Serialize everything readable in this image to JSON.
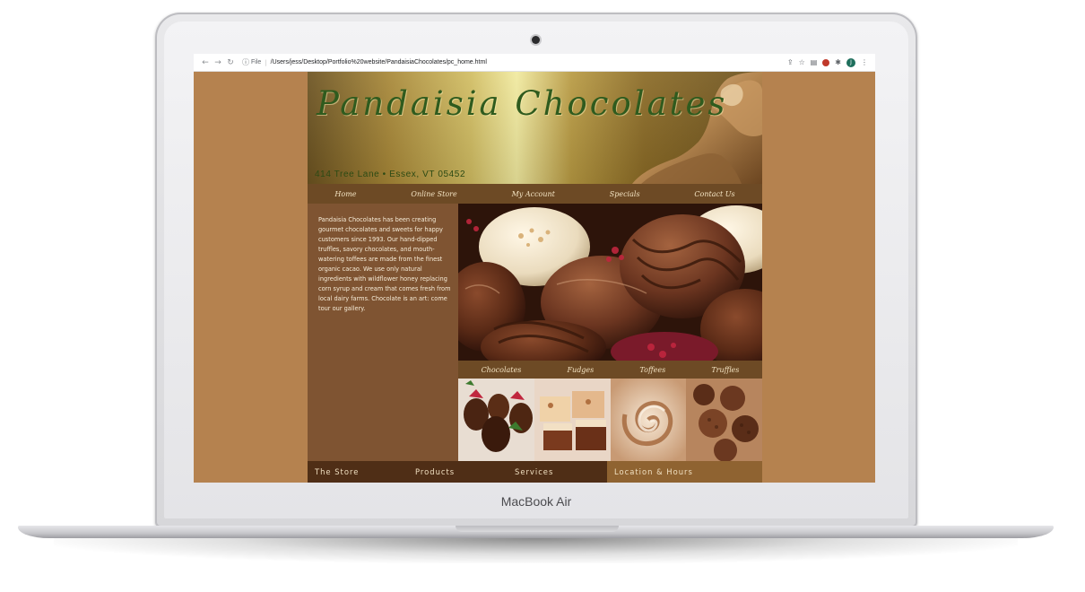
{
  "device": {
    "brand_label": "MacBook Air"
  },
  "browser": {
    "back_icon": "arrow-left-icon",
    "forward_icon": "arrow-right-icon",
    "reload_icon": "reload-icon",
    "protocol_label": "File",
    "url": "/Users/jess/Desktop/Portfolio%20website/PandaisiaChocolates/pc_home.html",
    "profile_initial": "J"
  },
  "site": {
    "title": "Pandaisia Chocolates",
    "address": "414 Tree Lane • Essex, VT 05452",
    "nav": [
      "Home",
      "Online Store",
      "My Account",
      "Specials",
      "Contact Us"
    ],
    "intro": "Pandaisia Chocolates has been creating gourmet chocolates and sweets for happy customers since 1993. Our hand-dipped truffles, savory chocolates, and mouth-watering toffees are made from the finest organic cacao. We use only natural ingredients with wildflower honey replacing corn syrup and cream that comes fresh from local dairy farms. Chocolate is an art: come tour our gallery.",
    "categories": [
      "Chocolates",
      "Fudges",
      "Toffees",
      "Truffles"
    ],
    "footer": [
      "The Store",
      "Products",
      "Services",
      "Location & Hours"
    ]
  },
  "colors": {
    "desktop_bg": "#b5824f",
    "page_bg": "#7f5432",
    "nav_bg": "#6d4a25",
    "footer_bg": "#4f2e16",
    "footer_active_bg": "#8f6331",
    "title_green": "#2f5b1e"
  }
}
